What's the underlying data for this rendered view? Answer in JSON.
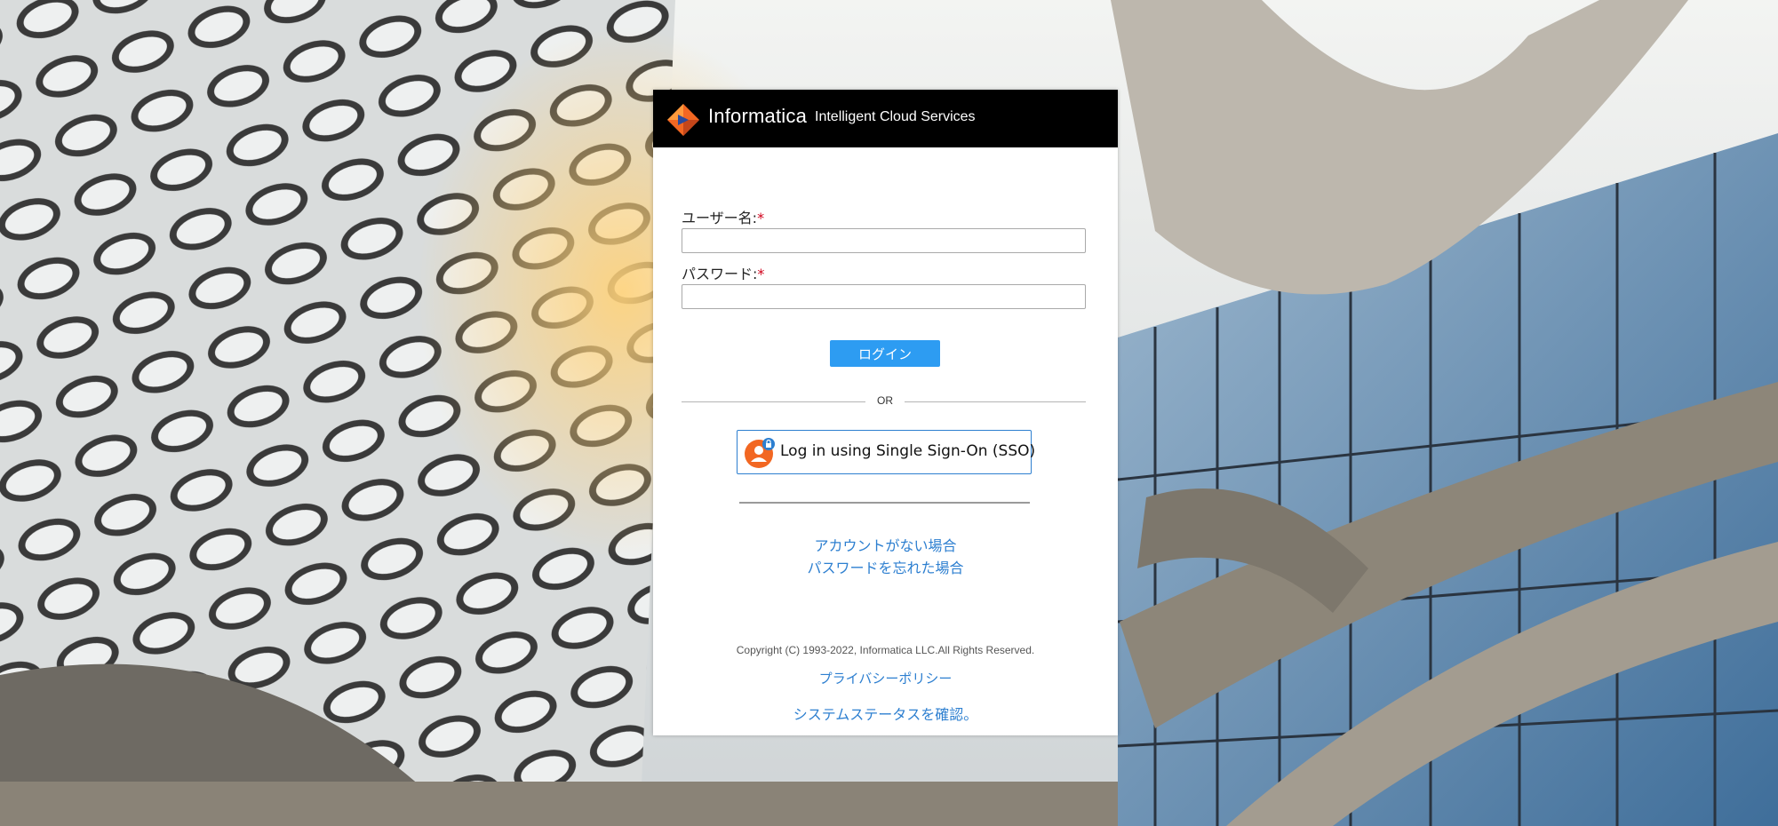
{
  "brand": {
    "name": "Informatica",
    "subtitle": "Intelligent Cloud Services"
  },
  "form": {
    "username_label": "ユーザー名:",
    "password_label": "パスワード:",
    "required_mark": "*",
    "username_value": "",
    "password_value": "",
    "login_button": "ログイン",
    "or_text": "OR",
    "sso_button": "Log in using Single Sign-On (SSO)"
  },
  "links": {
    "no_account": "アカウントがない場合",
    "forgot_password": "パスワードを忘れた場合",
    "privacy_policy": "プライバシーポリシー",
    "system_status": "システムステータスを確認。"
  },
  "footer": {
    "copyright": "Copyright (C) 1993-2022, Informatica LLC.All Rights Reserved."
  },
  "colors": {
    "accent": "#2d9cf2",
    "link": "#2d7fd0",
    "header": "#000000",
    "required": "#d0021b",
    "logo_orange": "#f26722",
    "logo_blue": "#2b4a9b"
  },
  "icons": {
    "logo": "informatica-logo-icon",
    "sso": "user-lock-icon"
  }
}
